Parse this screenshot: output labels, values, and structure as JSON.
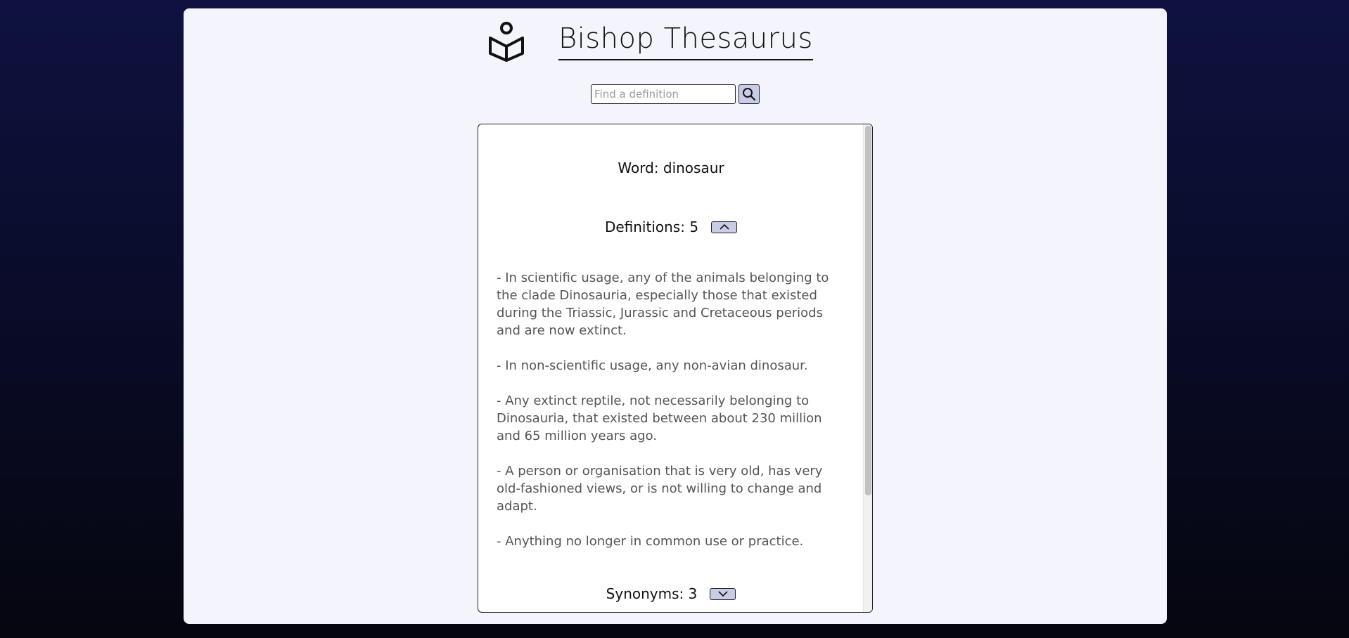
{
  "header": {
    "title": "Bishop Thesaurus",
    "logo_icon": "book-reader-icon"
  },
  "search": {
    "placeholder": "Find a definition",
    "value": "",
    "button_icon": "search-icon"
  },
  "result": {
    "word_label": "Word: dinosaur",
    "definitions": {
      "label": "Definitions: 5",
      "toggle_icon": "chevron-up-icon",
      "items": [
        "- In scientific usage, any of the animals belonging to the clade Dinosauria, especially those that existed during the Triassic, Jurassic and Cretaceous periods and are now extinct.",
        "- In non-scientific usage, any non-avian dinosaur.",
        "- Any extinct reptile, not necessarily belonging to Dinosauria, that existed between about 230 million and 65 million years ago.",
        "- A person or organisation that is very old, has very old-fashioned views, or is not willing to change and adapt.",
        "- Anything no longer in common use or practice."
      ]
    },
    "synonyms": {
      "label": "Synonyms: 3",
      "toggle_icon": "chevron-down-icon"
    }
  },
  "colors": {
    "background_top": "#0f1240",
    "background_bottom": "#05060f",
    "card": "#f4f4fd",
    "button": "#c9cce6",
    "text": "#111111",
    "definition_text": "#555555"
  }
}
